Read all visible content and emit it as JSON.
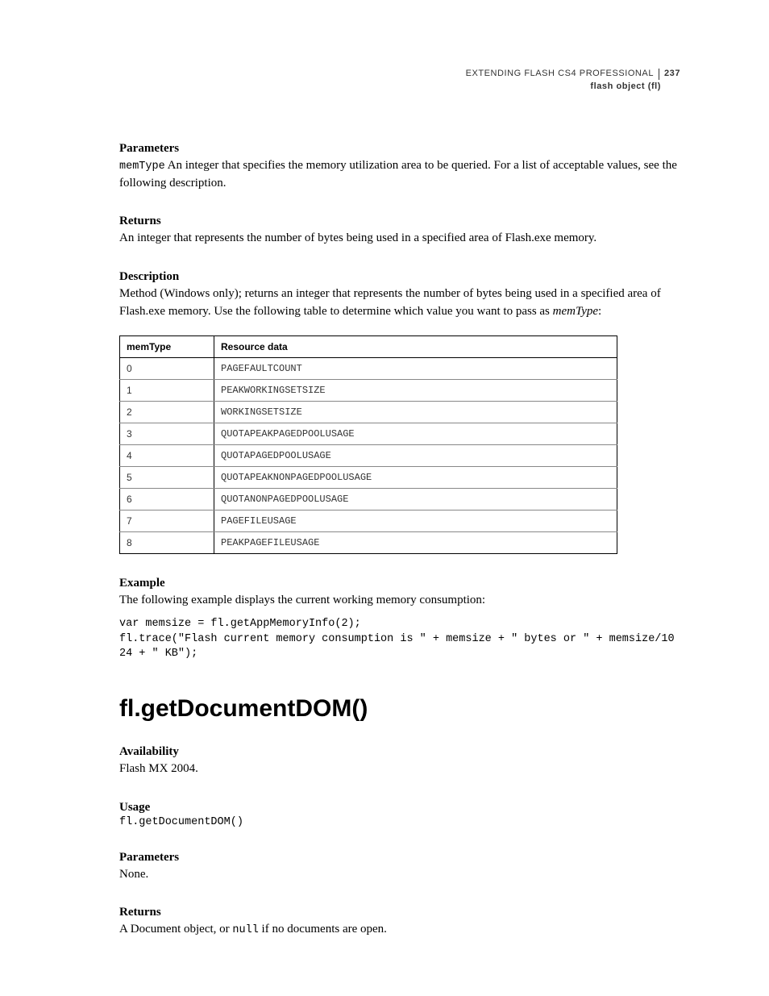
{
  "header": {
    "title": "EXTENDING FLASH CS4 PROFESSIONAL",
    "page_number": "237",
    "section": "flash object (fl)"
  },
  "sections": {
    "parameters1": {
      "label": "Parameters",
      "param_name": "memType",
      "text_after": "  An integer that specifies the memory utilization area to be queried. For a list of acceptable values, see the following description."
    },
    "returns1": {
      "label": "Returns",
      "text": "An integer that represents the number of bytes being used in a specified area of Flash.exe memory."
    },
    "description1": {
      "label": "Description",
      "text_a": "Method (Windows only); returns an integer that represents the number of bytes being used in a specified area of Flash.exe memory. Use the following table to determine which value you want to pass as ",
      "text_italic": "memType",
      "text_b": ":"
    },
    "table": {
      "headers": [
        "memType",
        "Resource data"
      ],
      "rows": [
        [
          "0",
          "PAGEFAULTCOUNT"
        ],
        [
          "1",
          "PEAKWORKINGSETSIZE"
        ],
        [
          "2",
          "WORKINGSETSIZE"
        ],
        [
          "3",
          "QUOTAPEAKPAGEDPOOLUSAGE"
        ],
        [
          "4",
          "QUOTAPAGEDPOOLUSAGE"
        ],
        [
          "5",
          "QUOTAPEAKNONPAGEDPOOLUSAGE"
        ],
        [
          "6",
          "QUOTANONPAGEDPOOLUSAGE"
        ],
        [
          "7",
          "PAGEFILEUSAGE"
        ],
        [
          "8",
          "PEAKPAGEFILEUSAGE"
        ]
      ]
    },
    "example1": {
      "label": "Example",
      "intro": "The following example displays the current working memory consumption:",
      "code": "var memsize = fl.getAppMemoryInfo(2);\nfl.trace(\"Flash current memory consumption is \" + memsize + \" bytes or \" + memsize/1024 + \" KB\");"
    },
    "api_heading": "fl.getDocumentDOM()",
    "availability": {
      "label": "Availability",
      "text": "Flash MX 2004."
    },
    "usage": {
      "label": "Usage",
      "code": "fl.getDocumentDOM()"
    },
    "parameters2": {
      "label": "Parameters",
      "text": "None."
    },
    "returns2": {
      "label": "Returns",
      "text_a": "A Document object, or ",
      "code": "null",
      "text_b": " if no documents are open."
    }
  }
}
